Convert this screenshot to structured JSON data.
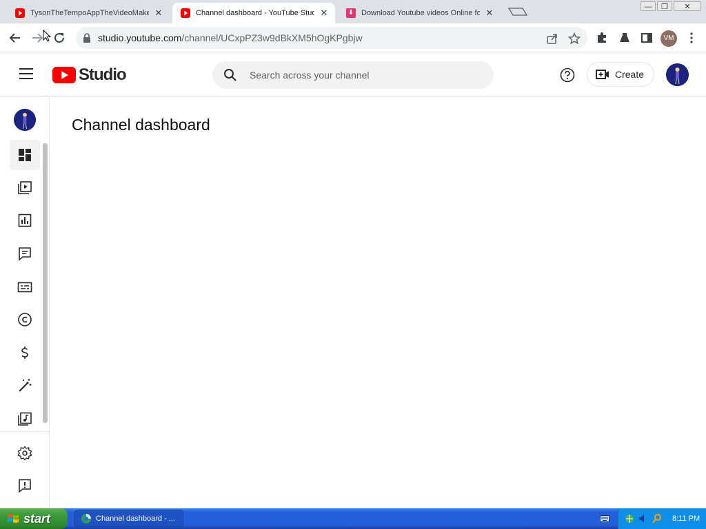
{
  "browser": {
    "tabs": [
      {
        "title": "TysonTheTempoAppTheVideoMaker..."
      },
      {
        "title": "Channel dashboard - YouTube Studio"
      },
      {
        "title": "Download Youtube videos Online fo..."
      }
    ],
    "url_host": "studio.youtube.com",
    "url_path": "/channel/UCxpPZ3w9dBkXM5hOgKPgbjw",
    "profile_initials": "VM"
  },
  "header": {
    "logo_text": "Studio",
    "search_placeholder": "Search across your channel",
    "create_label": "Create"
  },
  "sidebar": {
    "items": [
      {
        "icon": "dashboard-icon",
        "active": true
      },
      {
        "icon": "content-icon"
      },
      {
        "icon": "analytics-icon"
      },
      {
        "icon": "comments-icon"
      },
      {
        "icon": "subtitles-icon"
      },
      {
        "icon": "copyright-icon"
      },
      {
        "icon": "earn-icon"
      },
      {
        "icon": "customization-icon"
      },
      {
        "icon": "audio-library-icon"
      }
    ],
    "bottom": [
      {
        "icon": "settings-icon"
      },
      {
        "icon": "feedback-icon"
      }
    ]
  },
  "main": {
    "page_title": "Channel dashboard"
  },
  "taskbar": {
    "start_label": "start",
    "task_label": "Channel dashboard - ...",
    "clock": "8:11 PM"
  }
}
